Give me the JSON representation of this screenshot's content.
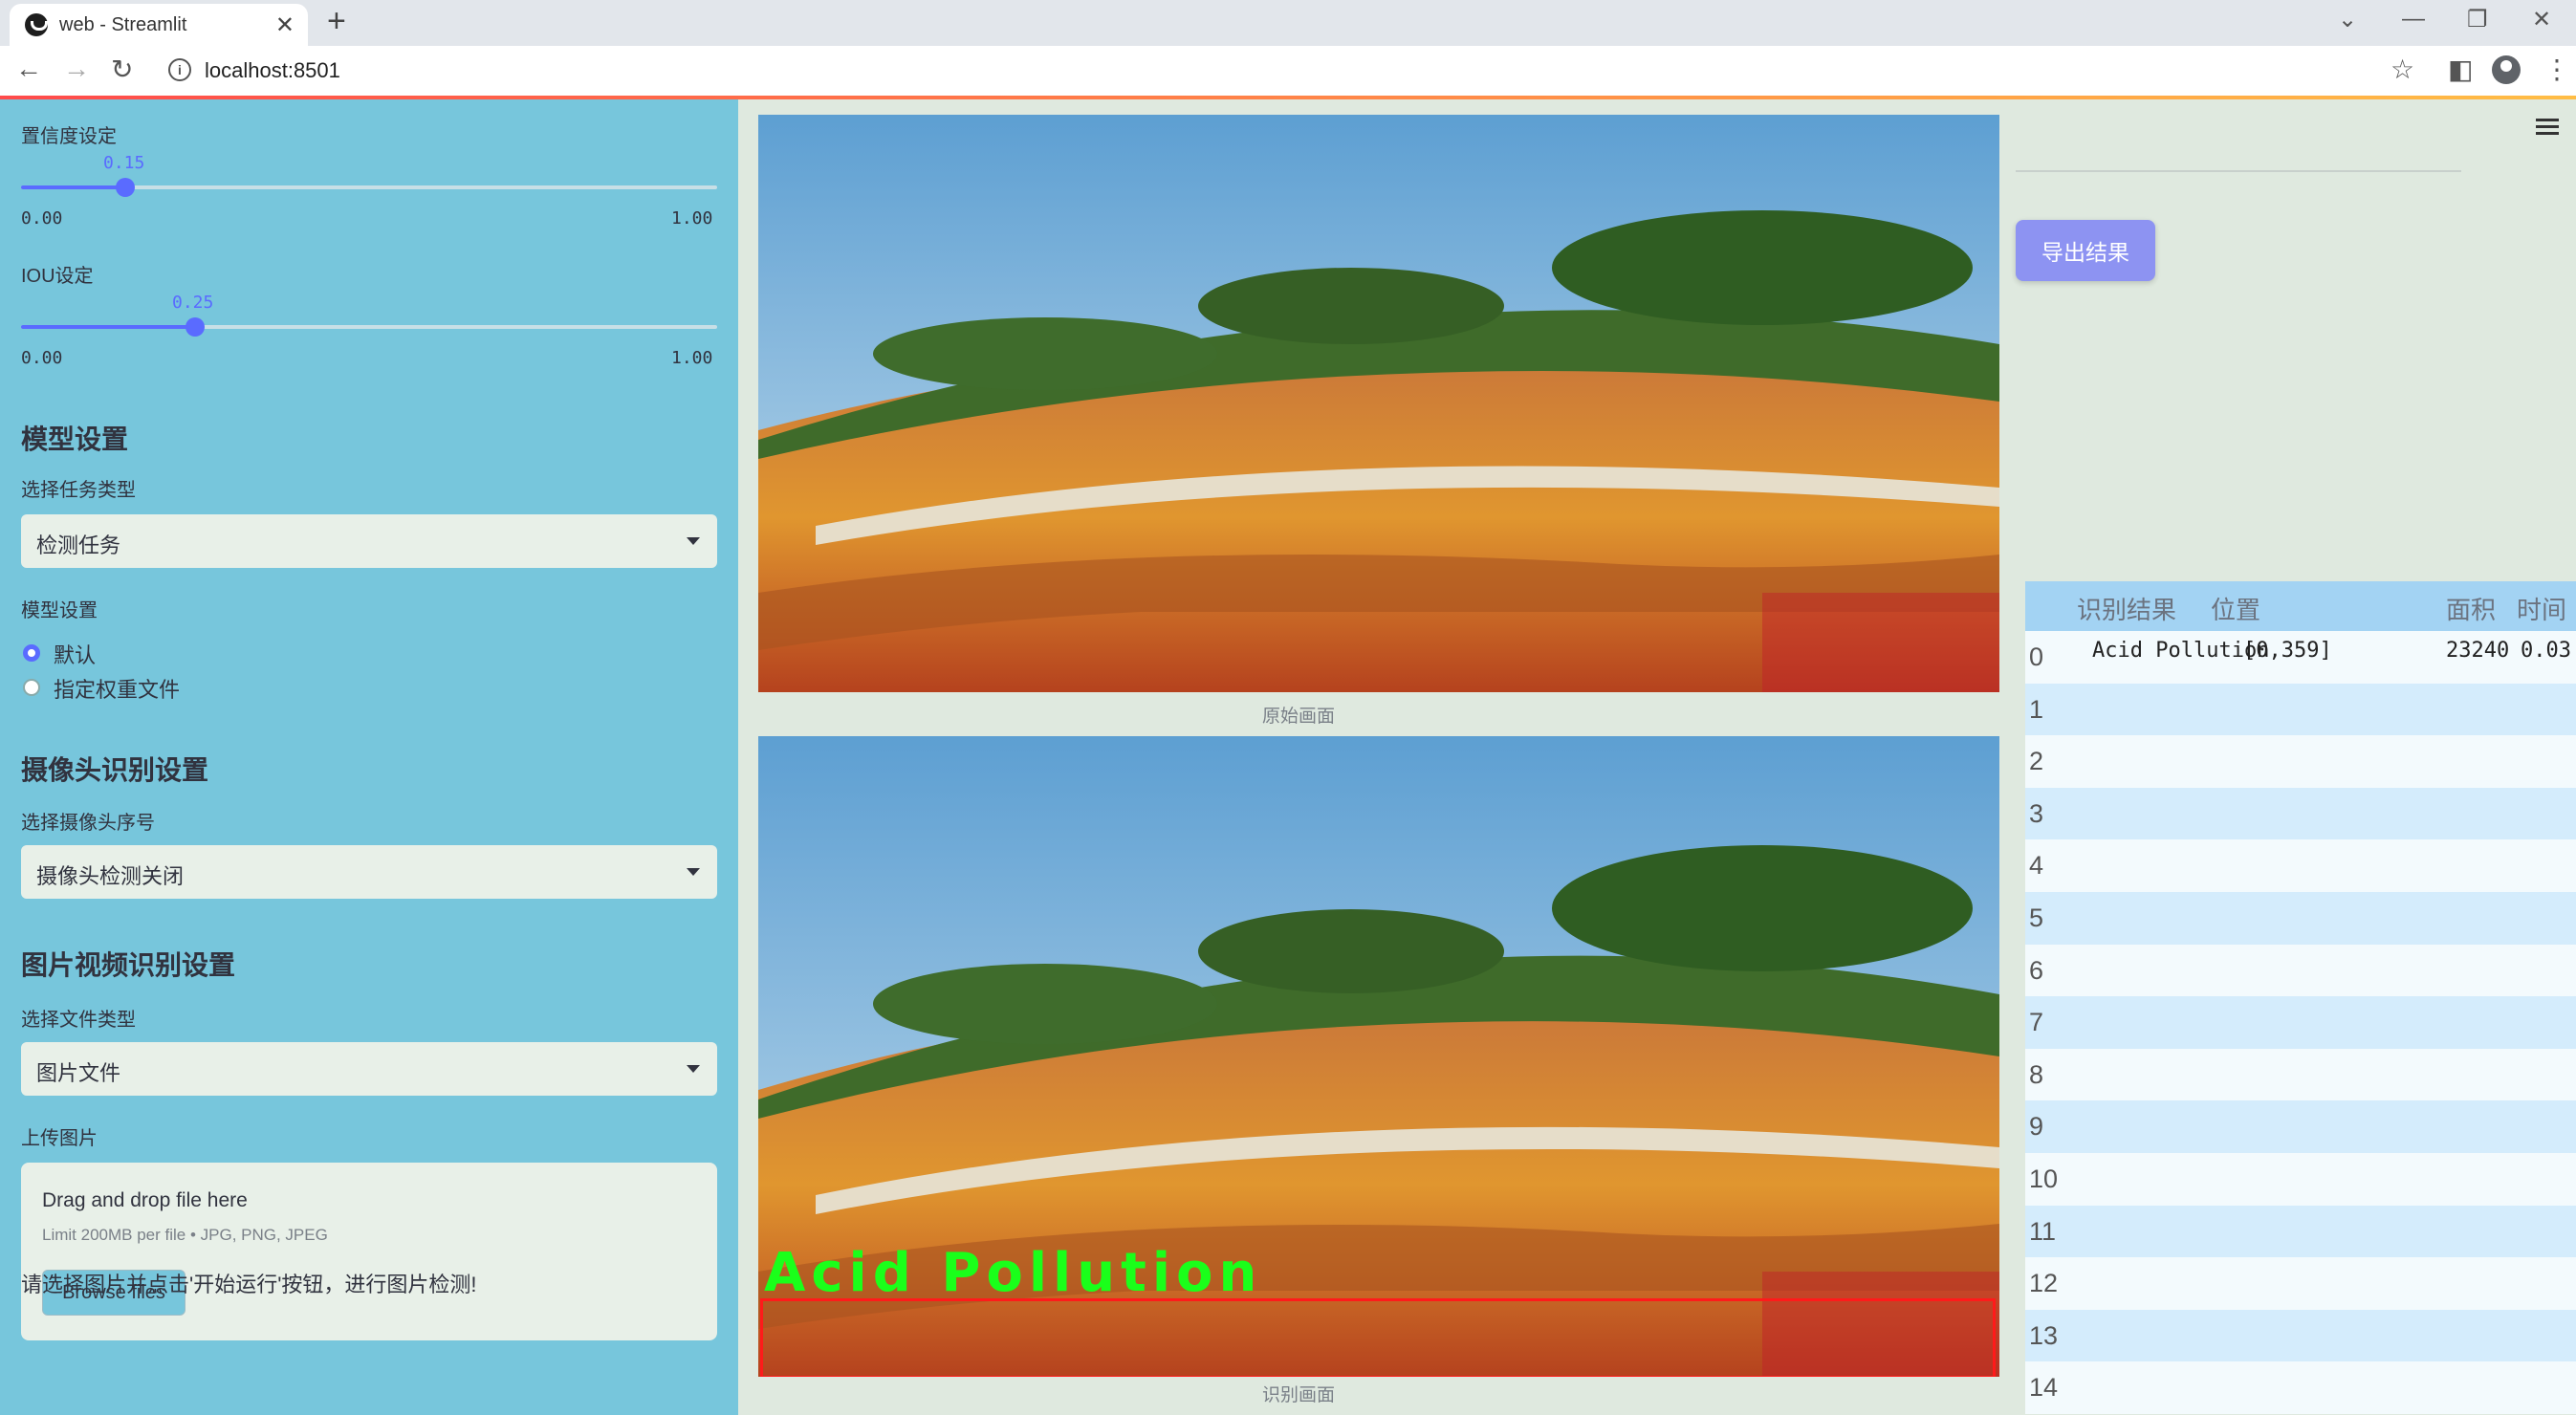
{
  "browser": {
    "tab_title": "web - Streamlit",
    "new_tab": "+",
    "url": "localhost:8501"
  },
  "sidebar": {
    "conf_slider": {
      "label": "置信度设定",
      "value": "0.15",
      "min": "0.00",
      "max": "1.00",
      "fraction": 0.15
    },
    "iou_slider": {
      "label": "IOU设定",
      "value": "0.25",
      "min": "0.00",
      "max": "1.00",
      "fraction": 0.25
    },
    "model_section": {
      "title": "模型设置",
      "task_label": "选择任务类型",
      "task_value": "检测任务",
      "weights_label": "模型设置",
      "options": [
        {
          "label": "默认",
          "selected": true
        },
        {
          "label": "指定权重文件",
          "selected": false
        }
      ]
    },
    "camera_section": {
      "title": "摄像头识别设置",
      "camera_label": "选择摄像头序号",
      "camera_value": "摄像头检测关闭"
    },
    "media_section": {
      "title": "图片视频识别设置",
      "file_type_label": "选择文件类型",
      "file_type_value": "图片文件",
      "upload_label": "上传图片",
      "drop_title": "Drag and drop file here",
      "drop_limit": "Limit 200MB per file • JPG, PNG, JPEG",
      "browse_label": "Browse files"
    },
    "hint": "请选择图片并点击'开始运行'按钮，进行图片检测!"
  },
  "images": {
    "original_caption": "原始画面",
    "result_caption": "识别画面",
    "detection_label": "Acid Pollution"
  },
  "results": {
    "export_label": "导出结果",
    "columns": [
      "识别结果",
      "位置",
      "面积",
      "时间"
    ],
    "rows": [
      {
        "index": "0",
        "result": "Acid Pollution",
        "position": "[0,359]",
        "area": "23240",
        "time": "0.03"
      },
      {
        "index": "1"
      },
      {
        "index": "2"
      },
      {
        "index": "3"
      },
      {
        "index": "4"
      },
      {
        "index": "5"
      },
      {
        "index": "6"
      },
      {
        "index": "7"
      },
      {
        "index": "8"
      },
      {
        "index": "9"
      },
      {
        "index": "10"
      },
      {
        "index": "11"
      },
      {
        "index": "12"
      },
      {
        "index": "13"
      },
      {
        "index": "14"
      }
    ]
  },
  "colors": {
    "sidebar_bg": "#77c6dc",
    "accent": "#5a6bff",
    "export_button": "#8d93f2",
    "detection_box": "#ff1a1a",
    "detection_text": "#1aff1a"
  }
}
